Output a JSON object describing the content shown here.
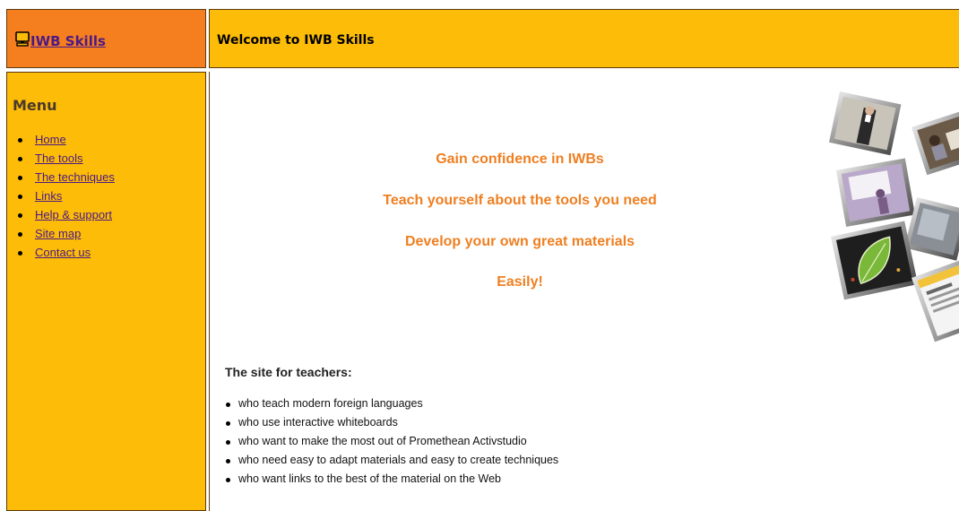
{
  "logo": {
    "text": "IWB Skills",
    "icon": "monitor-icon"
  },
  "header": {
    "title": "Welcome to IWB Skills"
  },
  "sidebar": {
    "title": "Menu",
    "items": [
      {
        "label": "Home"
      },
      {
        "label": "The tools"
      },
      {
        "label": "The techniques"
      },
      {
        "label": "Links"
      },
      {
        "label": "Help & support"
      },
      {
        "label": "Site map"
      },
      {
        "label": "Contact us"
      }
    ]
  },
  "main": {
    "taglines": [
      "Gain confidence in IWBs",
      "Teach yourself about the tools you need",
      "Develop your own great materials",
      "Easily!"
    ],
    "section_title": "The site for teachers:",
    "teacher_items": [
      "who teach modern foreign languages",
      "who use interactive whiteboards",
      "who want to make the most out of Promethean Activstudio",
      "who need easy to adapt materials and easy to create techniques",
      "who want links to the best of the material on the Web"
    ]
  },
  "colors": {
    "logo_bg": "#f57f1f",
    "header_bg": "#fdbc07",
    "tagline": "#ef7f21",
    "link": "#4b1a86"
  }
}
